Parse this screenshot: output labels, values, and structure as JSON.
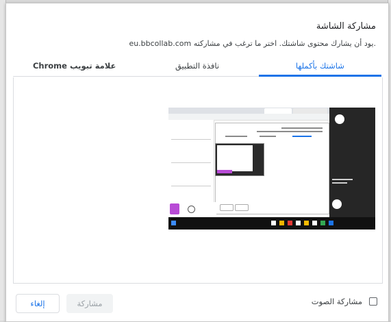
{
  "dialog": {
    "title": "مشاركة الشاشة",
    "subtitle": "eu.bbcollab.com يود أن يشارك محتوى شاشتك. اختر ما ترغب في مشاركته."
  },
  "tabs": [
    {
      "label": "شاشتك بأكملها",
      "active": true
    },
    {
      "label": "نافذة التطبيق",
      "active": false
    },
    {
      "label": "علامة تبويب Chrome",
      "active": false
    }
  ],
  "audio": {
    "label": "مشاركة الصوت",
    "checked": false
  },
  "buttons": {
    "share_label": "مشاركة",
    "cancel_label": "إلغاء"
  },
  "colors": {
    "accent": "#1a73e8",
    "disabled_text": "#9aa0a6"
  }
}
